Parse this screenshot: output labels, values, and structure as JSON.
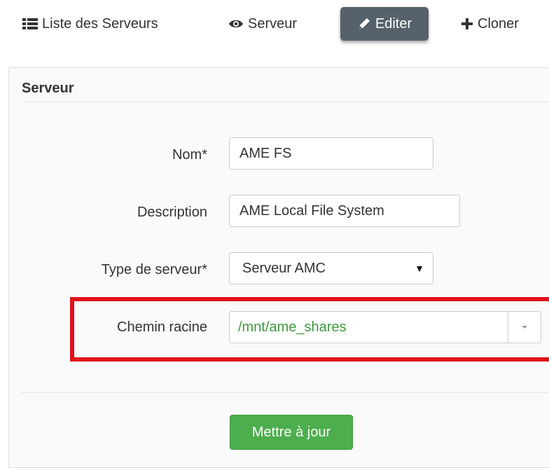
{
  "nav": {
    "list_label": "Liste des Serveurs",
    "view_label": "Serveur",
    "edit_label": "Editer",
    "clone_label": "Cloner",
    "list_icon": "list-icon",
    "view_icon": "eye-icon",
    "edit_icon": "pencil-icon",
    "clone_icon": "plus-icon"
  },
  "panel": {
    "title": "Serveur"
  },
  "form": {
    "name_label": "Nom*",
    "name_value": "AME FS",
    "description_label": "Description",
    "description_value": "AME Local File System",
    "type_label": "Type de serveur*",
    "type_value": "Serveur AMC",
    "root_label": "Chemin racine",
    "root_value": "/mnt/ame_shares",
    "submit_label": "Mettre à jour"
  },
  "colors": {
    "active_tab": "#56616b",
    "submit": "#4cae4c",
    "highlight": "#e0121b",
    "path_text": "#3c9a3c"
  }
}
